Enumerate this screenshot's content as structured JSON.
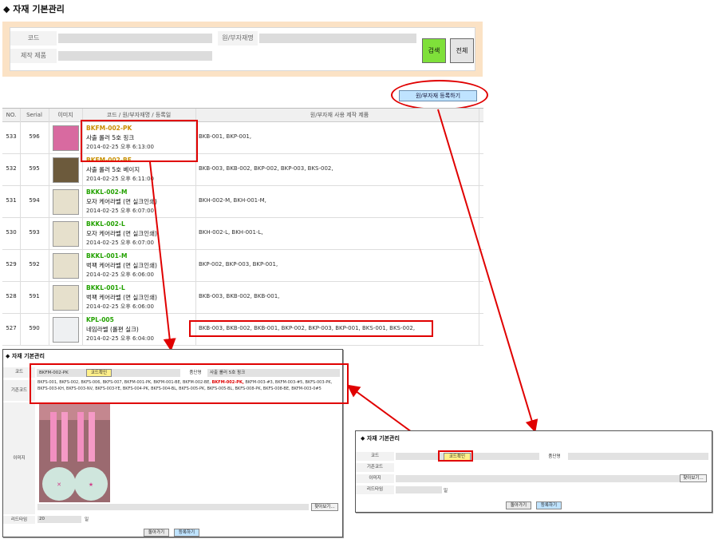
{
  "page": {
    "title": "◆ 자재 기본관리"
  },
  "search": {
    "code_label": "코드",
    "material_label": "원/부자재명",
    "product_label": "제작 제품",
    "search_button": "검색",
    "all_button": "전체"
  },
  "register_button": "원/부자재 등록하기",
  "table": {
    "headers": [
      "NO.",
      "Serial",
      "이미지",
      "코드 / 원/부자재명 / 등록일",
      "원/부자재 사용 제작 제품"
    ],
    "rows": [
      {
        "no": "533",
        "serial": "596",
        "code": "BKFM-002-PK",
        "name": "사출 롤러 5호 핑크",
        "date": "2014-02-25 오후 6:13:00",
        "products": "BKB-001, BKP-001,"
      },
      {
        "no": "532",
        "serial": "595",
        "code": "BKFM-002-BE",
        "name": "사출 롤러 5호 베이지",
        "date": "2014-02-25 오후 6:11:00",
        "products": "BKB-003, BKB-002, BKP-002, BKP-003, BKS-002,"
      },
      {
        "no": "531",
        "serial": "594",
        "code": "BKKL-002-M",
        "name": "모자 케어라벨 (면 실크인쇄)",
        "date": "2014-02-25 오후 6:07:00",
        "products": "BKH-002-M, BKH-001-M,"
      },
      {
        "no": "530",
        "serial": "593",
        "code": "BKKL-002-L",
        "name": "모자 케어라벨 (면 실크인쇄)",
        "date": "2014-02-25 오후 6:07:00",
        "products": "BKH-002-L, BKH-001-L,"
      },
      {
        "no": "529",
        "serial": "592",
        "code": "BKKL-001-M",
        "name": "벅팩 케어라벨 (면 실크인쇄)",
        "date": "2014-02-25 오후 6:06:00",
        "products": "BKP-002, BKP-003, BKP-001,"
      },
      {
        "no": "528",
        "serial": "591",
        "code": "BKKL-001-L",
        "name": "벅팩 케어라벨 (면 실크인쇄)",
        "date": "2014-02-25 오후 6:06:00",
        "products": "BKB-003, BKB-002, BKB-001,"
      },
      {
        "no": "527",
        "serial": "590",
        "code": "KPL-005",
        "name": "네임라벨 (롤편 실크)",
        "date": "2014-02-25 오후 6:04:00",
        "products": "BKB-003, BKB-002, BKB-001, BKP-002, BKP-003, BKP-001, BKS-001, BKS-002,"
      }
    ]
  },
  "detail_window": {
    "title": "◆ 자재 기본관리",
    "code_label": "코드",
    "code_value": "BKFM-002-PK",
    "check_button": "코드확인",
    "unit_label": "품단명",
    "unit_value": "사출 롤러 5호 핑크",
    "base_code_label": "기존코드",
    "base_codes_before": "BKFS-001, BKFS-002, BKFS-006, BKFS-007, BKFM-001-PK, BKFM-001-BE, BKFM-002-BE,",
    "base_codes_highlight": "BKFM-002-PK,",
    "base_codes_after": "BKFM-003-#3, BKFM-003-#5, BKFS-003-PK, BKFS-003-KH, BKFS-003-NV, BKFS-003-YE, BKFS-004-PK, BKFS-004-BL, BKFS-005-PK, BKFS-005-BL, BKFS-008-PK, BKFS-008-BE, BKFM-003-0#5",
    "image_label": "이미지",
    "find_button": "찾아보기...",
    "lead_label": "리드타임",
    "lead_value": "20",
    "lead_unit": "일",
    "back_button": "돌아가기",
    "register_button": "등록하기"
  },
  "new_window": {
    "title": "◆ 자재 기본관리",
    "code_label": "코드",
    "check_button": "코드확인",
    "unit_label": "품단명",
    "base_code_label": "기존코드",
    "image_label": "이미지",
    "find_button": "찾아보기...",
    "lead_label": "리드타임",
    "lead_unit": "일",
    "back_button": "돌아가기",
    "register_button": "등록하기"
  }
}
